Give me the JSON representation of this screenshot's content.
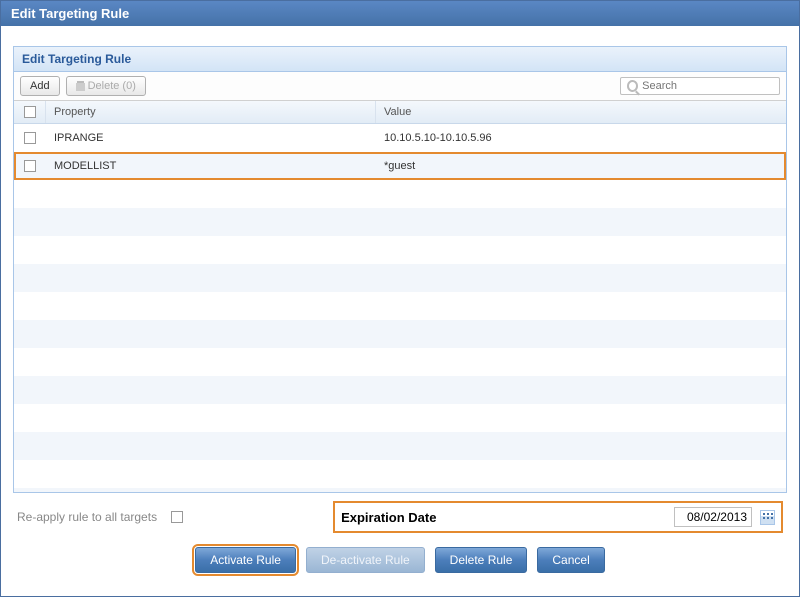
{
  "window": {
    "title": "Edit Targeting Rule"
  },
  "panel": {
    "title": "Edit Targeting Rule"
  },
  "toolbar": {
    "add_label": "Add",
    "delete_label": "Delete (0)",
    "search_placeholder": "Search"
  },
  "grid": {
    "headers": {
      "property": "Property",
      "value": "Value"
    },
    "rows": [
      {
        "property": "IPRANGE",
        "value": "10.10.5.10-10.10.5.96"
      },
      {
        "property": "MODELLIST",
        "value": "*guest"
      }
    ]
  },
  "footer": {
    "reapply_label": "Re-apply rule to all targets",
    "expiration_label": "Expiration Date",
    "expiration_value": "08/02/2013"
  },
  "buttons": {
    "activate": "Activate Rule",
    "deactivate": "De-activate Rule",
    "delete": "Delete Rule",
    "cancel": "Cancel"
  }
}
